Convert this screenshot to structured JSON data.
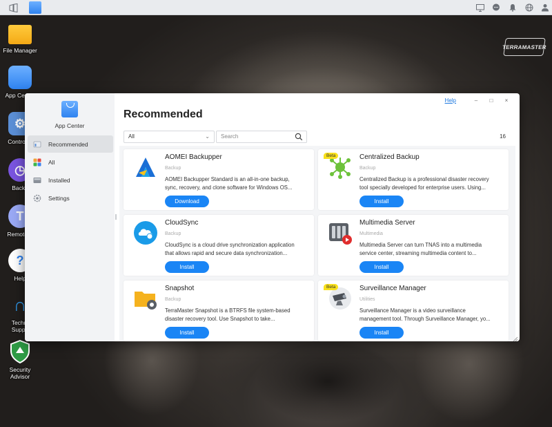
{
  "desktop": {
    "icons": [
      {
        "label": "File Manager",
        "icon": "folder-icon"
      },
      {
        "label": "App Center",
        "icon": "app-center-icon"
      },
      {
        "label": "Control P",
        "icon": "gear-icon"
      },
      {
        "label": "Backu",
        "icon": "backup-clock-icon"
      },
      {
        "label": "Remote A",
        "icon": "remote-access-icon"
      },
      {
        "label": "Help",
        "icon": "help-icon"
      },
      {
        "label": "Techni",
        "label2": "Suppo",
        "icon": "headset-icon"
      },
      {
        "label": "Security",
        "label2": "Advisor",
        "icon": "shield-icon"
      }
    ],
    "brand_logo": "TERRAMASTER"
  },
  "window": {
    "title": "App Center",
    "controls": {
      "help": "Help",
      "minimize": "–",
      "maximize": "□",
      "close": "×"
    },
    "page_title": "Recommended",
    "filter": {
      "selected": "All"
    },
    "search": {
      "placeholder": "Search"
    },
    "count": "16"
  },
  "sidebar": {
    "items": [
      {
        "label": "Recommended",
        "icon": "recommended-icon",
        "active": true
      },
      {
        "label": "All",
        "icon": "grid-icon",
        "active": false
      },
      {
        "label": "Installed",
        "icon": "installed-icon",
        "active": false
      },
      {
        "label": "Settings",
        "icon": "gear-icon",
        "active": false
      }
    ]
  },
  "apps": [
    {
      "name": "AOMEI Backupper",
      "category": "Backup",
      "desc1": "AOMEI Backupper Standard is an all-in-one backup,",
      "desc2": "sync, recovery, and clone software for Windows OS...",
      "button": "Download",
      "beta": false
    },
    {
      "name": "Centralized Backup",
      "category": "Backup",
      "desc1": "Centralized Backup is a professional disaster recovery",
      "desc2": "tool specially developed for enterprise users. Using...",
      "button": "Install",
      "beta": true,
      "beta_label": "Beta"
    },
    {
      "name": "CloudSync",
      "category": "Backup",
      "desc1": "CloudSync is a cloud drive synchronization application",
      "desc2": "that allows rapid and secure data synchronization...",
      "button": "Install",
      "beta": false
    },
    {
      "name": "Multimedia Server",
      "category": "Multimedia",
      "desc1": "Multimedia Server can turn TNAS into a multimedia",
      "desc2": "service center, streaming multimedia content to...",
      "button": "Install",
      "beta": false
    },
    {
      "name": "Snapshot",
      "category": "Backup",
      "desc1": "TerraMaster Snapshot is a BTRFS file system-based",
      "desc2": "disaster recovery tool. Use Snapshot to take...",
      "button": "Install",
      "beta": false
    },
    {
      "name": "Surveillance Manager",
      "category": "Utilities",
      "desc1": "Surveillance Manager is a video surveillance",
      "desc2": "management tool. Through Surveillance Manager, yo...",
      "button": "Install",
      "beta": true,
      "beta_label": "Beta"
    }
  ],
  "colors": {
    "accent": "#1a85f5",
    "beta": "#f8e01b"
  }
}
